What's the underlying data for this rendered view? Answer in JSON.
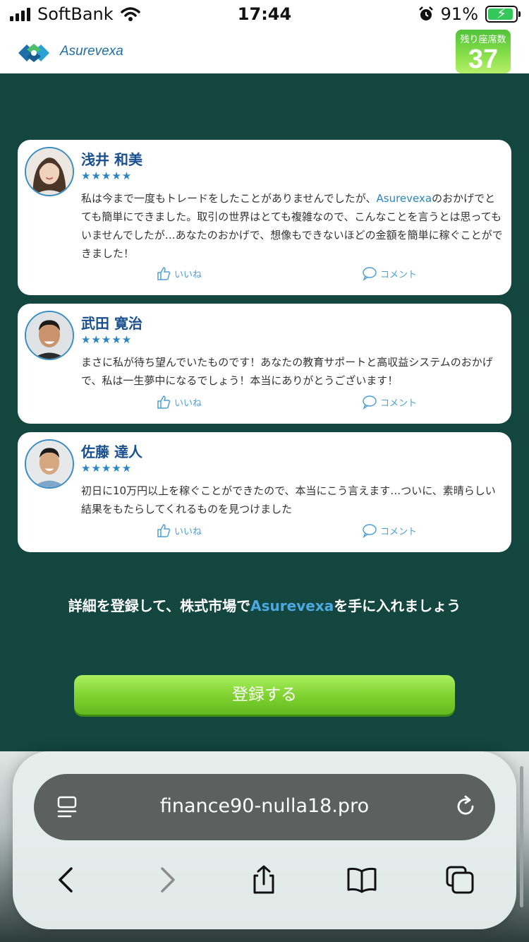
{
  "status_bar": {
    "carrier": "SoftBank",
    "time": "17:44",
    "battery_percent": "91%"
  },
  "header": {
    "brand": "Asurevexa",
    "seats_label": "残り座席数",
    "seats_count": "37"
  },
  "reviews": [
    {
      "name": "浅井 和美",
      "stars": "★★★★★",
      "text_before": "私は今まで一度もトレードをしたことがありませんでしたが、",
      "text_brand": "Asurevexa",
      "text_after": "のおかげでとても簡単にできました。取引の世界はとても複雑なので、こんなことを言うとは思ってもいませんでしたが…あなたのおかげで、想像もできないほどの金額を簡単に稼ぐことができました！",
      "like_label": "いいね",
      "comment_label": "コメント"
    },
    {
      "name": "武田 寛治",
      "stars": "★★★★★",
      "text": "まさに私が待ち望んでいたものです！あなたの教育サポートと高収益システムのおかげで、私は一生夢中になるでしょう！本当にありがとうございます！",
      "like_label": "いいね",
      "comment_label": "コメント"
    },
    {
      "name": "佐藤 達人",
      "stars": "★★★★★",
      "text": "初日に10万円以上を稼ぐことができたので、本当にこう言えます…ついに、素晴らしい結果をもたらしてくれるものを見つけました",
      "like_label": "いいね",
      "comment_label": "コメント"
    }
  ],
  "cta": {
    "text_before": "詳細を登録して、株式市場で",
    "text_brand": "Asurevexa",
    "text_after": "を手に入れましょう",
    "button_label": "登録する"
  },
  "browser": {
    "url": "finance90-nulla18.pro"
  },
  "colors": {
    "page_bg": "#12463f",
    "brand_blue": "#2a85c4",
    "button_green": "#7fd12f"
  }
}
